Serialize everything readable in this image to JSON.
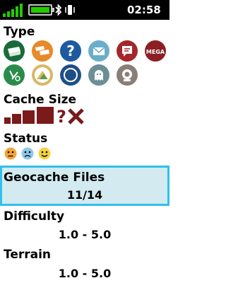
{
  "status_bar": {
    "time": "02:58",
    "battery_color": "#22cc00",
    "icons": [
      "signal-bars-icon",
      "battery-icon",
      "bluetooth-icon",
      "vibrate-icon"
    ]
  },
  "type_section": {
    "title": "Type",
    "icons": [
      {
        "name": "traditional-cache-icon",
        "color": "#1a6b3a"
      },
      {
        "name": "multi-cache-icon",
        "color": "#e8892a"
      },
      {
        "name": "mystery-cache-icon",
        "color": "#1e5aa0"
      },
      {
        "name": "letterbox-cache-icon",
        "color": "#6aaec8"
      },
      {
        "name": "event-cache-icon",
        "color": "#a3272b"
      },
      {
        "name": "mega-event-icon",
        "color": "#8b1f23",
        "label": "MEGA"
      },
      {
        "name": "cito-event-icon",
        "color": "#2a8c4a"
      },
      {
        "name": "earthcache-icon",
        "color": "#d8b864"
      },
      {
        "name": "wherigo-cache-icon",
        "color": "#1e4f86"
      },
      {
        "name": "virtual-cache-icon",
        "color": "#6b8f95"
      },
      {
        "name": "webcam-cache-icon",
        "color": "#8a7f77"
      }
    ]
  },
  "cache_size": {
    "title": "Cache Size",
    "color": "#7a1a1a",
    "icons": [
      "micro-size-icon",
      "small-size-icon",
      "regular-size-icon",
      "large-size-icon",
      "unknown-size-icon",
      "other-size-icon"
    ]
  },
  "status": {
    "title": "Status",
    "icons": [
      "not-found-face-icon",
      "sad-face-icon",
      "found-face-icon"
    ]
  },
  "geocache_files": {
    "title": "Geocache Files",
    "value": "11/14",
    "highlight_color": "#2ec1ea"
  },
  "difficulty": {
    "title": "Difficulty",
    "value": "1.0 - 5.0"
  },
  "terrain": {
    "title": "Terrain",
    "value": "1.0 - 5.0"
  }
}
